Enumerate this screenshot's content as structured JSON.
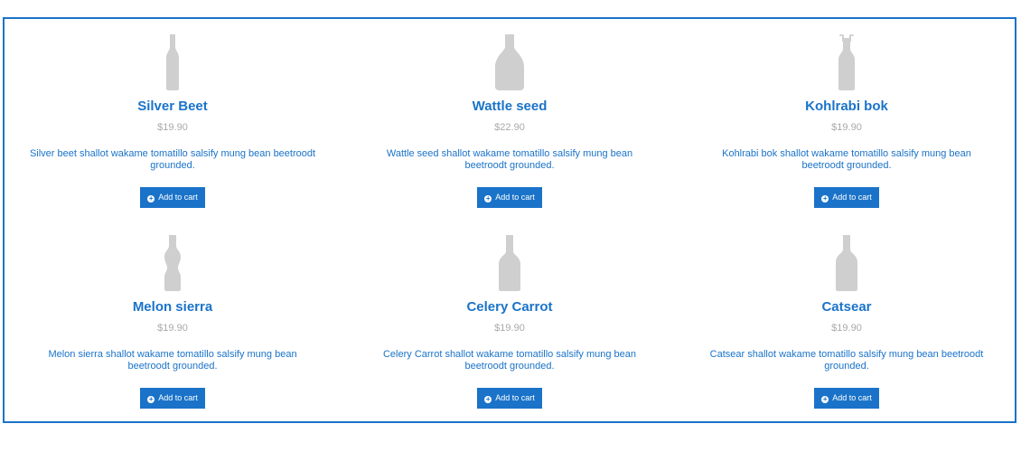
{
  "products": [
    {
      "name": "Silver Beet",
      "price": "$19.90",
      "description": "Silver beet shallot wakame tomatillo salsify mung bean beetroodt grounded.",
      "button_label": "Add to cart",
      "icon": "slim-bottle-icon"
    },
    {
      "name": "Wattle seed",
      "price": "$22.90",
      "description": "Wattle seed shallot wakame tomatillo salsify mung bean beetroodt grounded.",
      "button_label": "Add to cart",
      "icon": "decanter-bottle-icon"
    },
    {
      "name": "Kohlrabi bok",
      "price": "$19.90",
      "description": "Kohlrabi bok shallot wakame tomatillo salsify mung bean beetroodt grounded.",
      "button_label": "Add to cart",
      "icon": "swing-top-bottle-icon"
    },
    {
      "name": "Melon sierra",
      "price": "$19.90",
      "description": "Melon sierra shallot wakame tomatillo salsify mung bean beetroodt grounded.",
      "button_label": "Add to cart",
      "icon": "cola-bottle-icon"
    },
    {
      "name": "Celery Carrot",
      "price": "$19.90",
      "description": "Celery Carrot shallot wakame tomatillo salsify mung bean beetroodt grounded.",
      "button_label": "Add to cart",
      "icon": "flask-bottle-icon"
    },
    {
      "name": "Catsear",
      "price": "$19.90",
      "description": "Catsear shallot wakame tomatillo salsify mung bean beetroodt grounded.",
      "button_label": "Add to cart",
      "icon": "wide-bottle-icon"
    }
  ],
  "colors": {
    "accent": "#1a73c9",
    "price": "#a9a9a9",
    "bottle": "#cfcfcf",
    "button_text": "#ffffff"
  }
}
